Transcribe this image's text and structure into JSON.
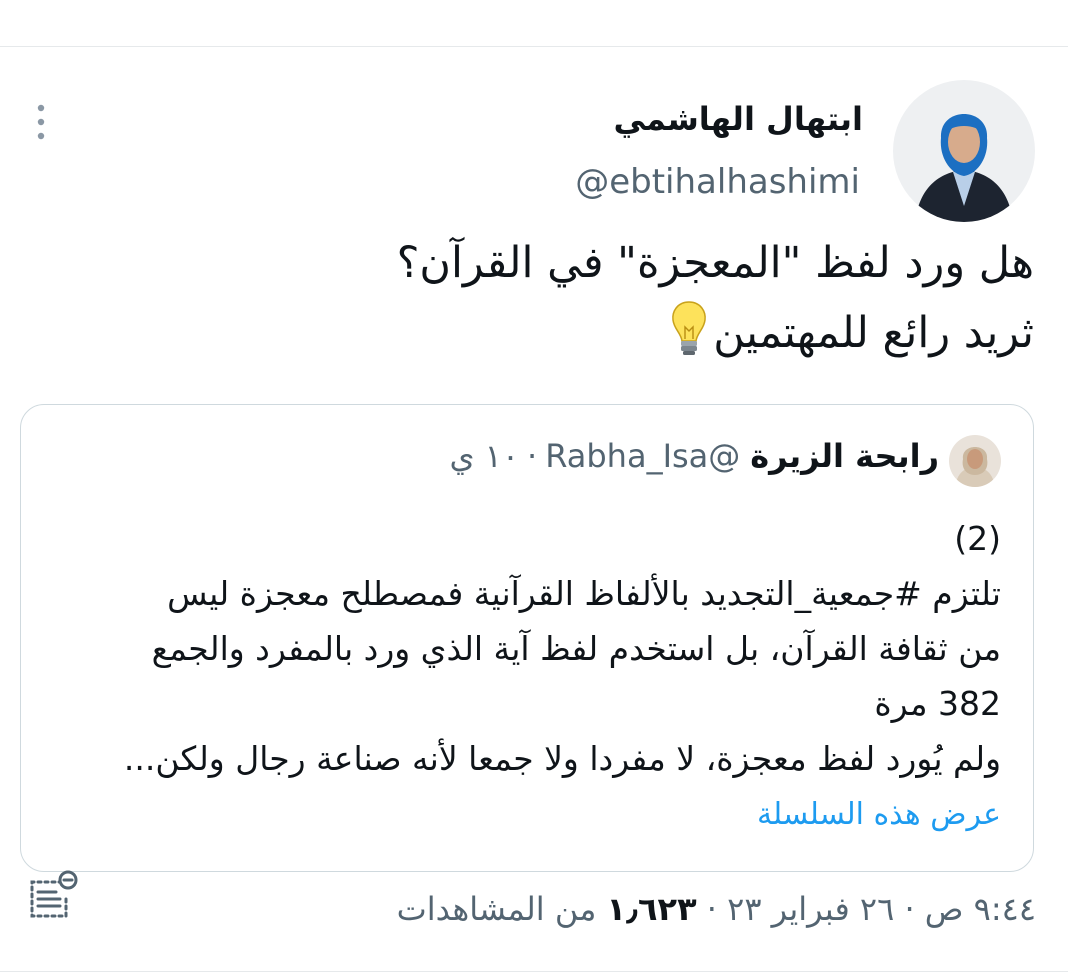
{
  "tweet": {
    "author_name": "ابتهال الهاشمي",
    "author_handle": "@ebtihalhashimi",
    "text_lines": [
      "هل ورد لفظ \"المعجزة\" في القرآن؟",
      "ثريد رائع للمهتمين"
    ],
    "emoji_icon": "lightbulb-icon"
  },
  "quote": {
    "author_name": "رابحة الزيرة",
    "author_handle": "@Rabha_Isa",
    "separator": "·",
    "time": "١٠ ي",
    "body_lines": [
      "(2)",
      "تلتزم #جمعية_التجديد بالألفاظ القرآنية فمصطلح معجزة ليس",
      "من ثقافة القرآن، بل استخدم لفظ آية الذي ورد بالمفرد والجمع",
      "382 مرة",
      "ولم يُورد لفظ معجزة، لا مفردا ولا جمعا لأنه صناعة رجال ولكن..."
    ],
    "show_thread_label": "عرض هذه السلسلة"
  },
  "meta": {
    "timestamp": "٩:٤٤ ص · ٢٦ فبراير ٢٣ · ",
    "views_count": "١٫٦٢٣",
    "views_label": " من المشاهدات"
  },
  "colors": {
    "text_primary": "#0f1419",
    "text_secondary": "#536471",
    "link": "#1d9bf0",
    "border": "#cfd9de"
  },
  "icons": [
    "more-vertical-icon",
    "lightbulb-icon",
    "analytics-icon"
  ]
}
